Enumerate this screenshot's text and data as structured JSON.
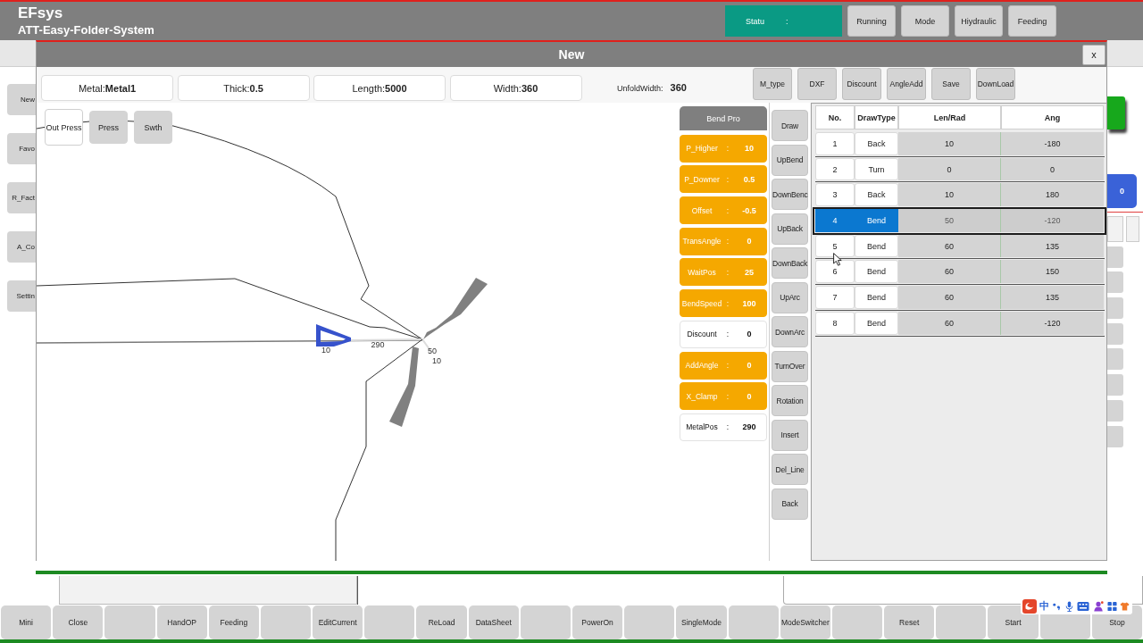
{
  "app": {
    "title": "EFsys",
    "subtitle": "ATT-Easy-Folder-System",
    "status": {
      "label": "Statu",
      "separator": ":"
    },
    "header_buttons": [
      "Running",
      "Mode",
      "Hiydraulic",
      "Feeding"
    ]
  },
  "background": {
    "sidebar_buttons": [
      "New",
      "Favo",
      "R_Fact",
      "A_Co",
      "Settin"
    ],
    "counter": "0"
  },
  "dialog": {
    "title": "New",
    "close_label": "x",
    "fields": [
      {
        "label": "Metal:",
        "value": "Metal1"
      },
      {
        "label": "Thick:",
        "value": "0.5"
      },
      {
        "label": "Length:",
        "value": "5000"
      },
      {
        "label": "Width:",
        "value": "360"
      }
    ],
    "unfold_width": {
      "label": "UnfoldWidth:",
      "value": "360"
    },
    "toolbar_buttons": [
      "M_type",
      "DXF",
      "Discount",
      "AngleAdd",
      "Save",
      "DownLoad"
    ],
    "drawing_tools": [
      {
        "label": "Out Press",
        "selected": true
      },
      {
        "label": "Press",
        "selected": false
      },
      {
        "label": "Swth",
        "selected": false
      }
    ],
    "drawing_labels": [
      "10",
      "290",
      "50",
      "10"
    ],
    "bend_pro": {
      "title": "Bend Pro",
      "params": [
        {
          "label": "P_Higher",
          "separator": ":",
          "value": "10",
          "highlighted": true
        },
        {
          "label": "P_Downer",
          "separator": ":",
          "value": "0.5",
          "highlighted": true
        },
        {
          "label": "Offset",
          "separator": ":",
          "value": "-0.5",
          "highlighted": true
        },
        {
          "label": "TransAngle",
          "separator": ":",
          "value": "0",
          "highlighted": true
        },
        {
          "label": "WaitPos",
          "separator": ":",
          "value": "25",
          "highlighted": true
        },
        {
          "label": "BendSpeed",
          "separator": ":",
          "value": "100",
          "highlighted": true
        },
        {
          "label": "Discount",
          "separator": ":",
          "value": "0",
          "highlighted": false
        },
        {
          "label": "AddAngle",
          "separator": ":",
          "value": "0",
          "highlighted": true
        },
        {
          "label": "X_Clamp",
          "separator": ":",
          "value": "0",
          "highlighted": true
        },
        {
          "label": "MetalPos",
          "separator": ":",
          "value": "290",
          "highlighted": false
        }
      ]
    },
    "action_buttons": [
      "Draw",
      "UpBend",
      "DownBenc",
      "UpBack",
      "DownBack",
      "UpArc",
      "DownArc",
      "TurnOver",
      "Rotation",
      "Insert",
      "Del_Line",
      "Back"
    ],
    "table": {
      "columns": [
        "No.",
        "DrawType",
        "Len/Rad",
        "Ang"
      ],
      "rows": [
        {
          "no": "1",
          "draw_type": "Back",
          "len_rad": "10",
          "ang": "-180",
          "selected": false
        },
        {
          "no": "2",
          "draw_type": "Turn",
          "len_rad": "0",
          "ang": "0",
          "selected": false
        },
        {
          "no": "3",
          "draw_type": "Back",
          "len_rad": "10",
          "ang": "180",
          "selected": false
        },
        {
          "no": "4",
          "draw_type": "Bend",
          "len_rad": "50",
          "ang": "-120",
          "selected": true
        },
        {
          "no": "5",
          "draw_type": "Bend",
          "len_rad": "60",
          "ang": "135",
          "selected": false
        },
        {
          "no": "6",
          "draw_type": "Bend",
          "len_rad": "60",
          "ang": "150",
          "selected": false
        },
        {
          "no": "7",
          "draw_type": "Bend",
          "len_rad": "60",
          "ang": "135",
          "selected": false
        },
        {
          "no": "8",
          "draw_type": "Bend",
          "len_rad": "60",
          "ang": "-120",
          "selected": false
        }
      ]
    }
  },
  "bottom_buttons": [
    {
      "kind": "labelled",
      "label": "Mini"
    },
    {
      "kind": "labelled",
      "label": "Close"
    },
    {
      "kind": "blank"
    },
    {
      "kind": "labelled",
      "label": "HandOP"
    },
    {
      "kind": "labelled",
      "label": "Feeding"
    },
    {
      "kind": "blank"
    },
    {
      "kind": "labelled",
      "label": "EditCurrent"
    },
    {
      "kind": "blank"
    },
    {
      "kind": "labelled",
      "label": "ReLoad"
    },
    {
      "kind": "labelled",
      "label": "DataSheet"
    },
    {
      "kind": "blank"
    },
    {
      "kind": "labelled",
      "label": "PowerOn"
    },
    {
      "kind": "blank"
    },
    {
      "kind": "labelled",
      "label": "SingleMode"
    },
    {
      "kind": "blank"
    },
    {
      "kind": "labelled",
      "label": "ModeSwitcher"
    },
    {
      "kind": "blank"
    },
    {
      "kind": "labelled",
      "label": "Reset"
    },
    {
      "kind": "blank"
    },
    {
      "kind": "labelled",
      "label": "Start"
    },
    {
      "kind": "blank"
    },
    {
      "kind": "labelled",
      "label": "Stop"
    }
  ],
  "ime_toolbar": {
    "mode": "中"
  }
}
